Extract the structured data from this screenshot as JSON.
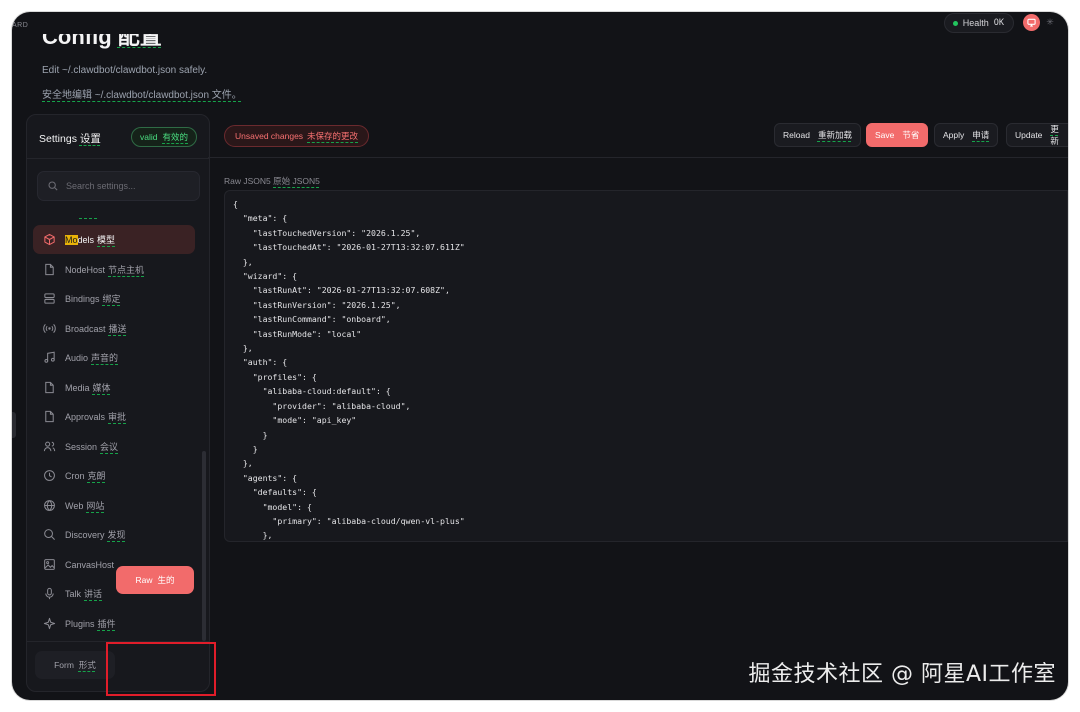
{
  "topbar": {
    "brand_fragment": "ARD",
    "health_label": "Health",
    "health_status": "OK"
  },
  "header": {
    "title_en": "Config",
    "title_cn": "配置",
    "subtitle_en": "Edit ~/.clawdbot/clawdbot.json safely.",
    "subtitle_cn": "安全地编辑 ~/.clawdbot/clawdbot.json 文件。"
  },
  "sidebar": {
    "title_en": "Settings",
    "title_cn": "设置",
    "valid_en": "valid",
    "valid_cn": "有效的",
    "search_placeholder": "Search settings...",
    "items": [
      {
        "label_en": "Models",
        "label_cn": "模型",
        "active": true
      },
      {
        "label_en": "NodeHost",
        "label_cn": "节点主机"
      },
      {
        "label_en": "Bindings",
        "label_cn": "绑定"
      },
      {
        "label_en": "Broadcast",
        "label_cn": "播送"
      },
      {
        "label_en": "Audio",
        "label_cn": "声音的"
      },
      {
        "label_en": "Media",
        "label_cn": "媒体"
      },
      {
        "label_en": "Approvals",
        "label_cn": "审批"
      },
      {
        "label_en": "Session",
        "label_cn": "会议"
      },
      {
        "label_en": "Cron",
        "label_cn": "克朗"
      },
      {
        "label_en": "Web",
        "label_cn": "网站"
      },
      {
        "label_en": "Discovery",
        "label_cn": "发现"
      },
      {
        "label_en": "CanvasHost",
        "label_cn": ""
      },
      {
        "label_en": "Talk",
        "label_cn": "讲话"
      },
      {
        "label_en": "Plugins",
        "label_cn": "插件"
      }
    ],
    "form_en": "Form",
    "form_cn": "形式",
    "raw_en": "Raw",
    "raw_cn": "生的"
  },
  "toolbar": {
    "unsaved_en": "Unsaved changes",
    "unsaved_cn": "未保存的更改",
    "reload_en": "Reload",
    "reload_cn": "重新加载",
    "save_en": "Save",
    "save_cn": "节省",
    "apply_en": "Apply",
    "apply_cn": "申请",
    "update_en": "Update",
    "update_cn": "更新"
  },
  "editor": {
    "label_en": "Raw JSON5",
    "label_cn": "原始 JSON5",
    "content": "{\n  \"meta\": {\n    \"lastTouchedVersion\": \"2026.1.25\",\n    \"lastTouchedAt\": \"2026-01-27T13:32:07.611Z\"\n  },\n  \"wizard\": {\n    \"lastRunAt\": \"2026-01-27T13:32:07.608Z\",\n    \"lastRunVersion\": \"2026.1.25\",\n    \"lastRunCommand\": \"onboard\",\n    \"lastRunMode\": \"local\"\n  },\n  \"auth\": {\n    \"profiles\": {\n      \"alibaba-cloud:default\": {\n        \"provider\": \"alibaba-cloud\",\n        \"mode\": \"api_key\"\n      }\n    }\n  },\n  \"agents\": {\n    \"defaults\": {\n      \"model\": {\n        \"primary\": \"alibaba-cloud/qwen-vl-plus\"\n      },"
  },
  "watermark": "掘金技术社区 @ 阿星AI工作室"
}
